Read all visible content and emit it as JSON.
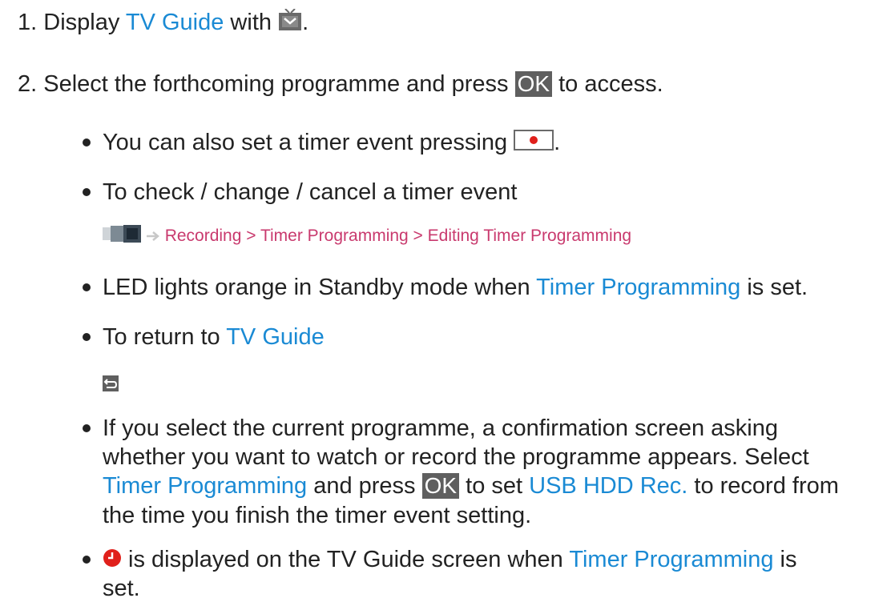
{
  "colors": {
    "link": "#1a8ad4",
    "menu_path": "#c93a6e",
    "ok_key_bg": "#5f5f5f",
    "text": "#222222"
  },
  "icons": {
    "guide": "tv-guide-button-icon",
    "record": "record-button-icon",
    "menu": "menu-apps-icon",
    "arrow": "arrow-right-icon",
    "back": "back-return-icon",
    "timer": "timer-clock-icon"
  },
  "steps": [
    {
      "number": "1.",
      "parts": {
        "a": "Display ",
        "link": "TV Guide",
        "b": " with ",
        "c": "."
      }
    },
    {
      "number": "2.",
      "parts": {
        "a": "Select the forthcoming programme and press ",
        "ok": "OK",
        "b": " to access."
      }
    }
  ],
  "bullets": {
    "timer_key": {
      "text": "You can also set a timer event pressing ",
      "end": "."
    },
    "check_change": {
      "text": "To check / change / cancel a timer event",
      "path": "Recording > Timer Programming > Editing Timer Programming"
    },
    "led": {
      "a": "LED lights orange in Standby mode when ",
      "link": "Timer Programming",
      "b": " is set."
    },
    "return": {
      "a": "To return to ",
      "link": "TV Guide"
    },
    "current": {
      "line1": "If you select the current programme, a confirmation screen asking",
      "line2": "whether you want to watch or record the programme appears. Select",
      "line3_link": "Timer Programming",
      "line3_a": " and press ",
      "line3_ok": "OK",
      "line3_b": " to set ",
      "line3_link2": "USB HDD Rec.",
      "line3_c": " to record from",
      "line4": "the time you finish the timer event setting."
    },
    "timer_icon": {
      "a": " is displayed on the TV Guide screen when ",
      "link": "Timer Programming",
      "b": " is",
      "line2": "set."
    }
  }
}
